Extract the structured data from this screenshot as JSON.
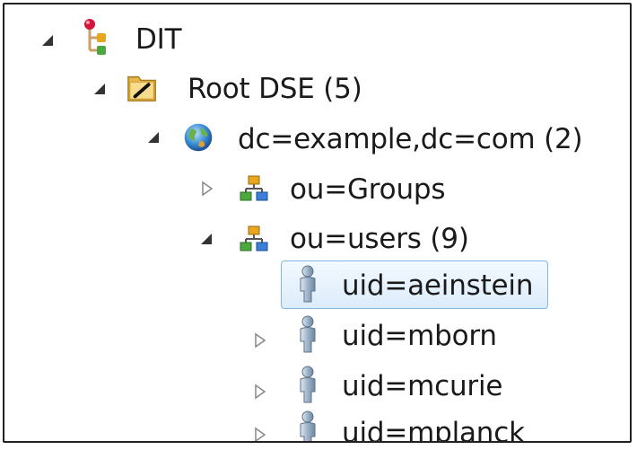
{
  "tree": {
    "nodes": [
      {
        "id": "dit",
        "label": "DIT",
        "icon": "dit-tree-icon",
        "expanded": true,
        "level": 0
      },
      {
        "id": "root-dse",
        "label": "Root DSE (5)",
        "icon": "folder-edit-icon",
        "expanded": true,
        "level": 1
      },
      {
        "id": "dc-example",
        "label": "dc=example,dc=com (2)",
        "icon": "globe-icon",
        "expanded": true,
        "level": 2
      },
      {
        "id": "ou-groups",
        "label": "ou=Groups",
        "icon": "org-unit-icon",
        "expanded": false,
        "level": 3
      },
      {
        "id": "ou-users",
        "label": "ou=users (9)",
        "icon": "org-unit-icon",
        "expanded": true,
        "level": 3
      },
      {
        "id": "uid-aeinstein",
        "label": "uid=aeinstein",
        "icon": "person-icon",
        "expanded": false,
        "selected": true,
        "level": 4
      },
      {
        "id": "uid-mborn",
        "label": "uid=mborn",
        "icon": "person-icon",
        "expanded": false,
        "level": 4
      },
      {
        "id": "uid-mcurie",
        "label": "uid=mcurie",
        "icon": "person-icon",
        "expanded": false,
        "level": 4
      },
      {
        "id": "uid-mplanck",
        "label": "uid=mplanck",
        "icon": "person-icon",
        "expanded": false,
        "level": 4
      }
    ]
  },
  "colors": {
    "selection_border": "#7fb8e0",
    "selection_fill": "#dcecfb",
    "text": "#1a1a1a"
  }
}
